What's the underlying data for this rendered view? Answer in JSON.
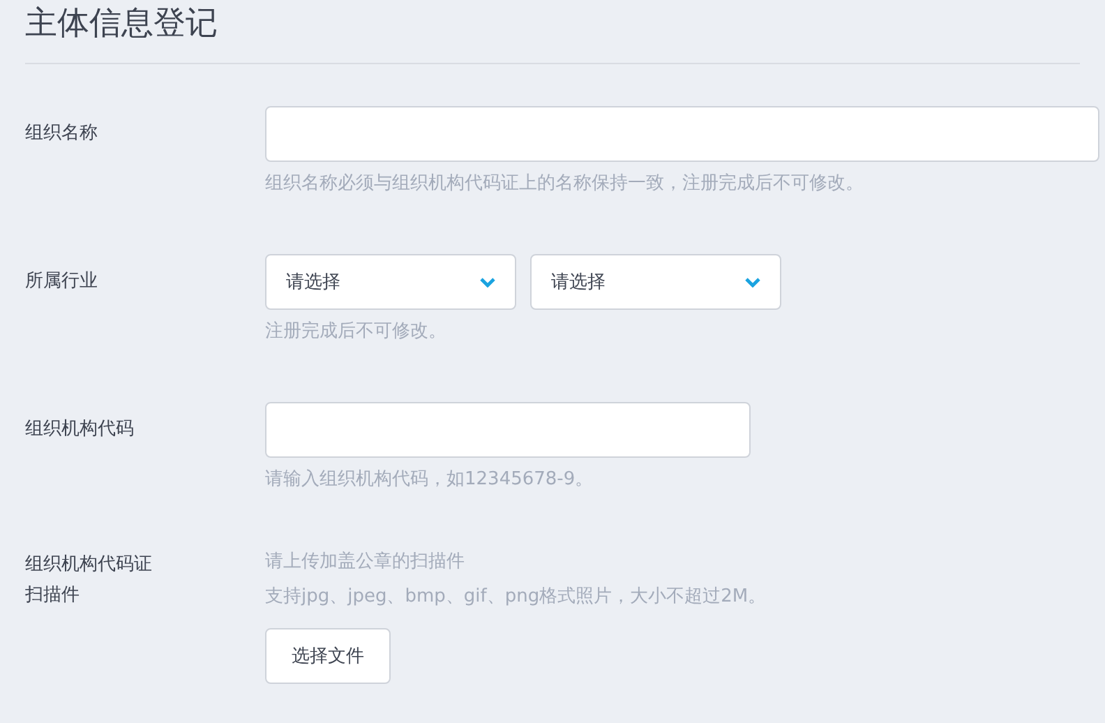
{
  "title": "主体信息登记",
  "fields": [
    {
      "kind": "text",
      "label": "组织名称",
      "wide": true,
      "hints": [
        "组织名称必须与组织机构代码证上的名称保持一致，注册完成后不可修改。"
      ]
    },
    {
      "kind": "select",
      "label": "所属行业",
      "selects": [
        {
          "placeholder": "请选择"
        },
        {
          "placeholder": "请选择"
        }
      ],
      "hints": [
        "注册完成后不可修改。"
      ]
    },
    {
      "kind": "text",
      "label": "组织机构代码",
      "wide": false,
      "hints": [
        "请输入组织机构代码，如12345678-9。"
      ]
    },
    {
      "kind": "upload",
      "label": "组织机构代码证扫描件",
      "hints": [
        "请上传加盖公章的扫描件",
        "支持jpg、jpeg、bmp、gif、png格式照片，大小不超过2M。"
      ],
      "button": "选择文件"
    }
  ]
}
